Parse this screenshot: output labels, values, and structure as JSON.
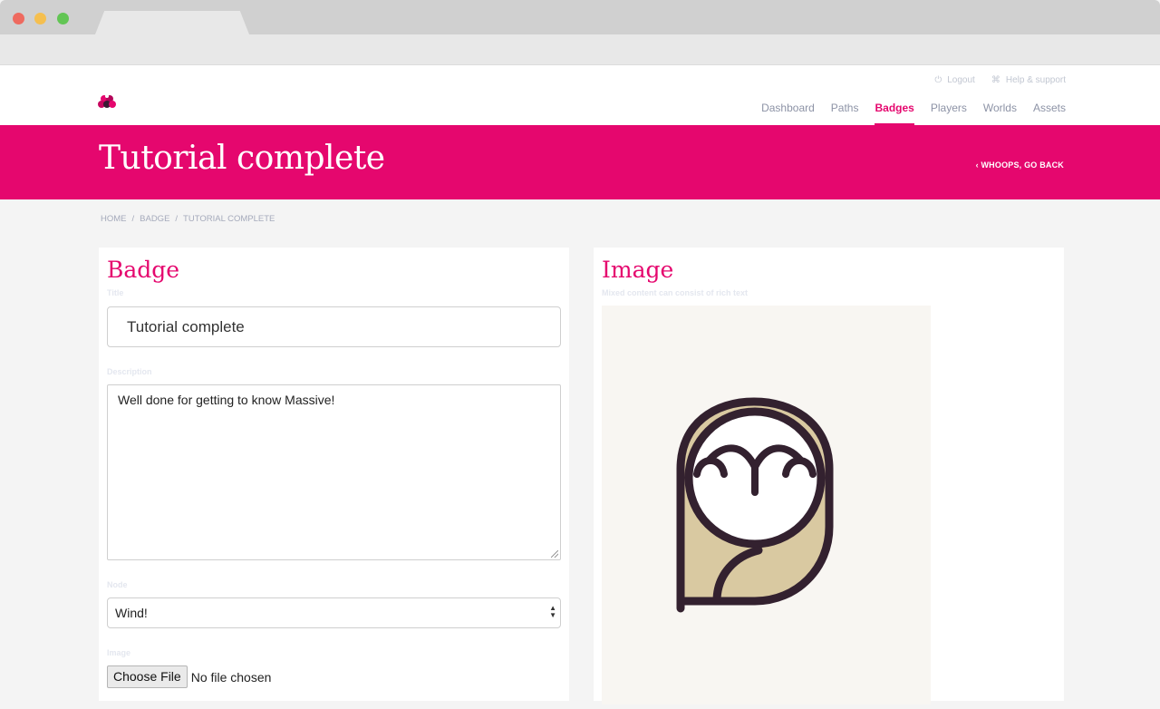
{
  "header": {
    "utility_links": [
      {
        "label": "Logout",
        "icon": "power-icon"
      },
      {
        "label": "Help & support",
        "icon": "help-icon"
      }
    ],
    "nav": [
      {
        "label": "Dashboard",
        "active": false
      },
      {
        "label": "Paths",
        "active": false
      },
      {
        "label": "Badges",
        "active": true
      },
      {
        "label": "Players",
        "active": false
      },
      {
        "label": "Worlds",
        "active": false
      },
      {
        "label": "Assets",
        "active": false
      }
    ]
  },
  "hero": {
    "title": "Tutorial complete",
    "back_label": "WHOOPS, GO BACK",
    "back_icon": "chevron-left-icon"
  },
  "breadcrumb": [
    "HOME",
    "BADGE",
    "TUTORIAL COMPLETE"
  ],
  "badge_form": {
    "heading": "Badge",
    "title_label": "Title",
    "title_value": "Tutorial complete",
    "description_label": "Description",
    "description_value": "Well done for getting to know Massive!",
    "node_label": "Node",
    "node_value": "Wind!",
    "image_label": "Image",
    "file_button": "Choose File",
    "file_status": "No file chosen"
  },
  "image_panel": {
    "heading": "Image",
    "subtitle": "Mixed content can consist of rich text",
    "image_icon": "owl-icon"
  },
  "colors": {
    "brand": "#e5076e",
    "owl_outline": "#33212f",
    "owl_fill": "#d9c9a1",
    "preview_bg": "#f8f6f2"
  }
}
